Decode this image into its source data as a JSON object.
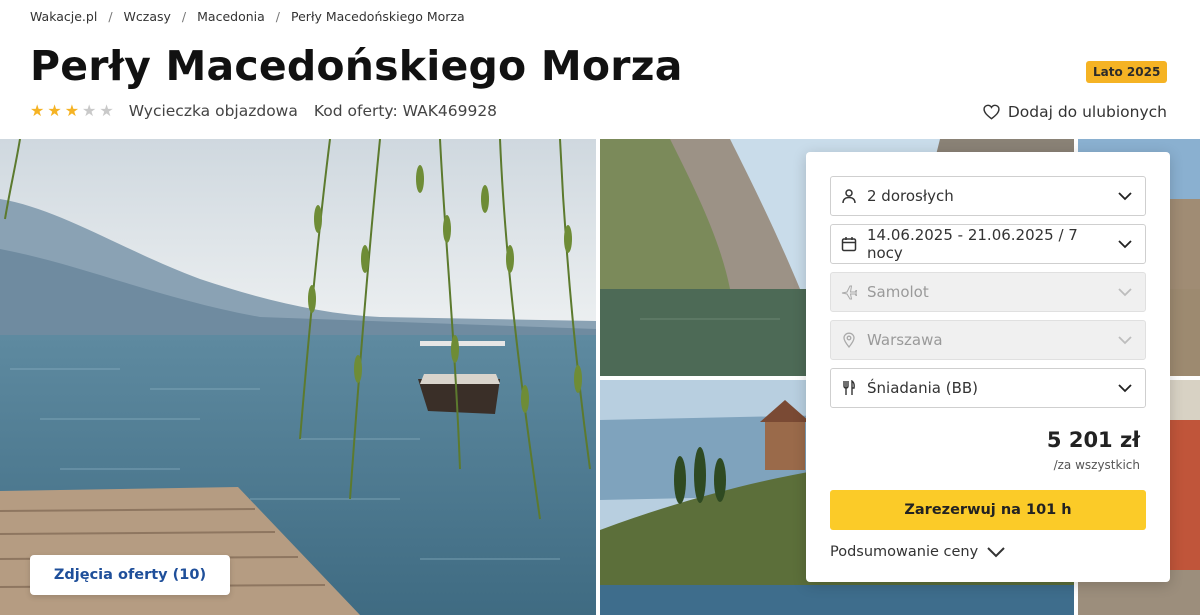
{
  "breadcrumb": [
    "Wakacje.pl",
    "Wczasy",
    "Macedonia",
    "Perły Macedońskiego Morza"
  ],
  "title": "Perły Macedońskiego Morza",
  "badge": "Lato 2025",
  "rating": {
    "value": 3,
    "max": 5
  },
  "trip_type": "Wycieczka objazdowa",
  "offer_code": "Kod oferty: WAK469928",
  "favorites_label": "Dodaj do ulubionych",
  "photos_button": "Zdjęcia oferty (10)",
  "booking": {
    "travelers": {
      "icon": "person-icon",
      "value": "2 dorosłych"
    },
    "dates": {
      "icon": "calendar-icon",
      "value": "14.06.2025 - 21.06.2025 / 7 nocy"
    },
    "transport": {
      "icon": "plane-icon",
      "value": "Samolot",
      "disabled": true
    },
    "departure": {
      "icon": "location-pin-icon",
      "value": "Warszawa",
      "disabled": true
    },
    "board": {
      "icon": "cutlery-icon",
      "value": "Śniadania (BB)"
    },
    "price": "5 201 zł",
    "price_note": "/za wszystkich",
    "book_button": "Zarezerwuj na 101 h",
    "summary_link": "Podsumowanie ceny"
  },
  "colors": {
    "accent": "#fbcb28",
    "badge": "#f5b324",
    "link_blue": "#1f4f9a"
  }
}
